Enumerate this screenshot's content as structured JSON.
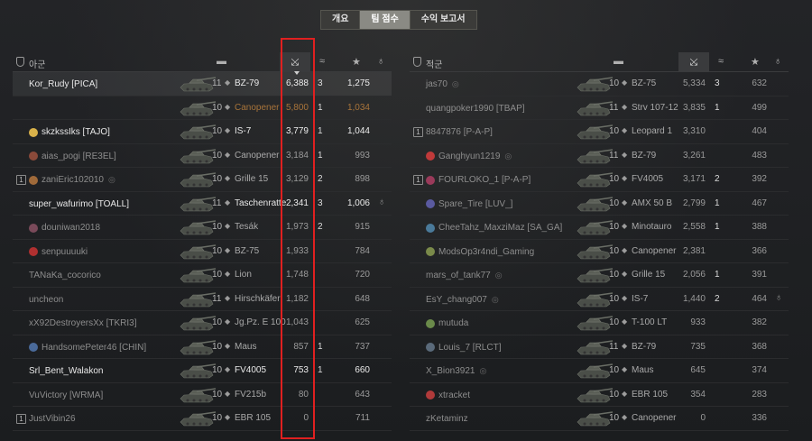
{
  "tabs": [
    "개요",
    "팀 점수",
    "수익 보고서"
  ],
  "active_tab": 1,
  "teams": [
    {
      "name": "아군",
      "header_icons": [
        "tank-icon",
        "damage-icon",
        "kills-icon",
        "xp-star-icon",
        "medal-icon"
      ],
      "players": [
        {
          "player": "Kor_Rudy [PICA]",
          "platform": "",
          "badge": "",
          "tier": "11",
          "tank": "BZ-79",
          "damage": "6,388",
          "kills": "3",
          "xp": "1,275",
          "medal": "",
          "style": "bright",
          "hl": true
        },
        {
          "player": "",
          "platform": "",
          "badge": "",
          "tier": "10",
          "tank": "Canopener",
          "damage": "5,800",
          "kills": "1",
          "xp": "1,034",
          "medal": "",
          "style": "orange"
        },
        {
          "player": "skzkssIks [TAJO]",
          "platform": "",
          "badge": "#d9b24a",
          "tier": "10",
          "tank": "IS-7",
          "damage": "3,779",
          "kills": "1",
          "xp": "1,044",
          "medal": "",
          "style": "bright"
        },
        {
          "player": "aias_pogi [RE3EL]",
          "platform": "",
          "badge": "#8a4a3a",
          "tier": "10",
          "tank": "Canopener",
          "damage": "3,184",
          "kills": "1",
          "xp": "993",
          "medal": "",
          "style": "dim"
        },
        {
          "player": "zaniEric102010",
          "platform": "1",
          "badge": "#a06a3a",
          "tier": "10",
          "tank": "Grille 15",
          "damage": "3,129",
          "kills": "2",
          "xp": "898",
          "medal": "",
          "style": "dim",
          "eye": true
        },
        {
          "player": "super_wafurimo [TOALL]",
          "platform": "",
          "badge": "",
          "tier": "11",
          "tank": "Taschenratte",
          "damage": "2,341",
          "kills": "3",
          "xp": "1,006",
          "medal": "♁",
          "style": "bright"
        },
        {
          "player": "douniwan2018",
          "platform": "",
          "badge": "#7a4a5a",
          "tier": "10",
          "tank": "Tesák",
          "damage": "1,973",
          "kills": "2",
          "xp": "915",
          "medal": "",
          "style": "dim"
        },
        {
          "player": "senpuuuuki",
          "platform": "",
          "badge": "#b03030",
          "tier": "10",
          "tank": "BZ-75",
          "damage": "1,933",
          "kills": "",
          "xp": "784",
          "medal": "",
          "style": "dim"
        },
        {
          "player": "TANaKa_cocorico",
          "platform": "",
          "badge": "",
          "tier": "10",
          "tank": "Lion",
          "damage": "1,748",
          "kills": "",
          "xp": "720",
          "medal": "",
          "style": "dim"
        },
        {
          "player": "uncheon",
          "platform": "",
          "badge": "",
          "tier": "11",
          "tank": "Hirschkäfer",
          "damage": "1,182",
          "kills": "",
          "xp": "648",
          "medal": "",
          "style": "dim"
        },
        {
          "player": "xX92DestroyersXx [TKRI3]",
          "platform": "",
          "badge": "",
          "tier": "10",
          "tank": "Jg.Pz. E 100",
          "damage": "1,043",
          "kills": "",
          "xp": "625",
          "medal": "",
          "style": "dim"
        },
        {
          "player": "HandsomePeter46 [CHIN]",
          "platform": "",
          "badge": "#4a6a9a",
          "tier": "10",
          "tank": "Maus",
          "damage": "857",
          "kills": "1",
          "xp": "737",
          "medal": "",
          "style": "dim"
        },
        {
          "player": "Srl_Bent_Walakon",
          "platform": "",
          "badge": "",
          "tier": "10",
          "tank": "FV4005",
          "damage": "753",
          "kills": "1",
          "xp": "660",
          "medal": "",
          "style": "bright"
        },
        {
          "player": "VuVictory [WRMA]",
          "platform": "",
          "badge": "",
          "tier": "10",
          "tank": "FV215b",
          "damage": "80",
          "kills": "",
          "xp": "643",
          "medal": "",
          "style": "dim"
        },
        {
          "player": "JustVibin26",
          "platform": "1",
          "badge": "",
          "tier": "10",
          "tank": "EBR 105",
          "damage": "0",
          "kills": "",
          "xp": "711",
          "medal": "",
          "style": "dim"
        }
      ]
    },
    {
      "name": "적군",
      "header_icons": [
        "tank-icon",
        "damage-icon",
        "kills-icon",
        "xp-star-icon",
        "medal-icon"
      ],
      "players": [
        {
          "player": "jas70",
          "platform": "",
          "badge": "",
          "tier": "10",
          "tank": "BZ-75",
          "damage": "5,334",
          "kills": "3",
          "xp": "632",
          "medal": "",
          "style": "dim",
          "eye": true
        },
        {
          "player": "quangpoker1990 [TBAP]",
          "platform": "",
          "badge": "",
          "tier": "11",
          "tank": "Strv 107-12",
          "damage": "3,835",
          "kills": "1",
          "xp": "499",
          "medal": "",
          "style": "dim"
        },
        {
          "player": "8847876 [P-A-P]",
          "platform": "1",
          "badge": "",
          "tier": "10",
          "tank": "Leopard 1",
          "damage": "3,310",
          "kills": "",
          "xp": "404",
          "medal": "",
          "style": "dim"
        },
        {
          "player": "Ganghyun1219",
          "platform": "",
          "badge": "#c03a3a",
          "tier": "11",
          "tank": "BZ-79",
          "damage": "3,261",
          "kills": "",
          "xp": "483",
          "medal": "",
          "style": "dim",
          "eye": true
        },
        {
          "player": "FOURLOKO_1 [P-A-P]",
          "platform": "1",
          "badge": "#9a3a5a",
          "tier": "10",
          "tank": "FV4005",
          "damage": "3,171",
          "kills": "2",
          "xp": "392",
          "medal": "",
          "style": "dim"
        },
        {
          "player": "Spare_Tire [LUV_]",
          "platform": "",
          "badge": "#5a5aa0",
          "tier": "10",
          "tank": "AMX 50 B",
          "damage": "2,799",
          "kills": "1",
          "xp": "467",
          "medal": "",
          "style": "dim"
        },
        {
          "player": "CheeTahz_MaxziMaz [SA_GA]",
          "platform": "",
          "badge": "#4a7a9a",
          "tier": "10",
          "tank": "Minotauro",
          "damage": "2,558",
          "kills": "1",
          "xp": "388",
          "medal": "",
          "style": "dim"
        },
        {
          "player": "ModsOp3r4ndi_Gaming",
          "platform": "",
          "badge": "#7a8a4a",
          "tier": "10",
          "tank": "Canopener",
          "damage": "2,381",
          "kills": "",
          "xp": "366",
          "medal": "",
          "style": "dim"
        },
        {
          "player": "mars_of_tank77",
          "platform": "",
          "badge": "",
          "tier": "10",
          "tank": "Grille 15",
          "damage": "2,056",
          "kills": "1",
          "xp": "391",
          "medal": "",
          "style": "dim",
          "eye": true
        },
        {
          "player": "EsY_chang007",
          "platform": "",
          "badge": "",
          "tier": "10",
          "tank": "IS-7",
          "damage": "1,440",
          "kills": "2",
          "xp": "464",
          "medal": "♁",
          "style": "dim",
          "eye": true
        },
        {
          "player": "mutuda",
          "platform": "",
          "badge": "#6a8a4a",
          "tier": "10",
          "tank": "T-100 LT",
          "damage": "933",
          "kills": "",
          "xp": "382",
          "medal": "",
          "style": "dim"
        },
        {
          "player": "Louis_7 [RLCT]",
          "platform": "",
          "badge": "#5a6a7a",
          "tier": "11",
          "tank": "BZ-79",
          "damage": "735",
          "kills": "",
          "xp": "368",
          "medal": "",
          "style": "dim"
        },
        {
          "player": "X_Bion3921",
          "platform": "",
          "badge": "",
          "tier": "10",
          "tank": "Maus",
          "damage": "645",
          "kills": "",
          "xp": "374",
          "medal": "",
          "style": "dim",
          "eye": true
        },
        {
          "player": "xtracket",
          "platform": "",
          "badge": "#b03a3a",
          "tier": "10",
          "tank": "EBR 105",
          "damage": "354",
          "kills": "",
          "xp": "283",
          "medal": "",
          "style": "dim"
        },
        {
          "player": "zKetaminz",
          "platform": "",
          "badge": "",
          "tier": "10",
          "tank": "Canopener",
          "damage": "0",
          "kills": "",
          "xp": "336",
          "medal": "",
          "style": "dim"
        }
      ]
    }
  ]
}
